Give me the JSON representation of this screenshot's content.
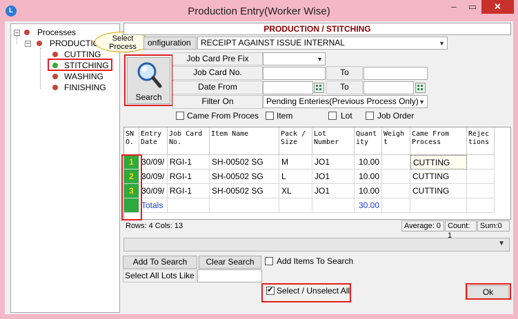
{
  "window": {
    "title": "Production Entry(Worker Wise)",
    "app_icon": "L",
    "min_glyph": "–",
    "max_glyph": "▭",
    "close_glyph": "✕"
  },
  "tree": {
    "root": "Processes",
    "parent": "PRODUCTION",
    "items": [
      "CUTTING",
      "STITCHING",
      "WASHING",
      "FINISHING"
    ],
    "selected": "STITCHING"
  },
  "callout": {
    "line1": "Select",
    "line2": "Process"
  },
  "header": {
    "title": "PRODUCTION / STITCHING"
  },
  "config": {
    "button_label": "onfiguration",
    "selected_value": "RECEIPT AGAINST ISSUE INTERNAL"
  },
  "search": {
    "button_label": "Search"
  },
  "fields": {
    "job_card_prefix_label": "Job Card Pre Fix",
    "job_card_no_label": "Job Card No.",
    "date_from_label": "Date From",
    "filter_on_label": "Filter On",
    "to_label": "To",
    "filter_value": "Pending Enteries(Previous Process Only)"
  },
  "checks": {
    "came_from_process": "Came  From Proces",
    "item": "Item",
    "lot": "Lot",
    "job_order": "Job Order"
  },
  "grid": {
    "headers": [
      "SN\nO.",
      "Entry\nDate",
      "Job Card\nNo.",
      "Item Name",
      "Pack /\nSize",
      "Lot\nNumber",
      "Quant\nity",
      "Weigh\nt",
      "Came From\nProcess",
      "Rejec\ntions"
    ],
    "rows": [
      {
        "sn": "1",
        "entry_date": "30/09/",
        "job_card": "RGI-1",
        "item": "SH-00502 SG",
        "pack_size": "M",
        "lot": "JO1",
        "qty": "10.00",
        "weight": "",
        "came_from": "CUTTING",
        "rejections": ""
      },
      {
        "sn": "2",
        "entry_date": "30/09/",
        "job_card": "RGI-1",
        "item": "SH-00502 SG",
        "pack_size": "L",
        "lot": "JO1",
        "qty": "10.00",
        "weight": "",
        "came_from": "CUTTING",
        "rejections": ""
      },
      {
        "sn": "3",
        "entry_date": "30/09/",
        "job_card": "RGI-1",
        "item": "SH-00502 SG",
        "pack_size": "XL",
        "lot": "JO1",
        "qty": "10.00",
        "weight": "",
        "came_from": "CUTTING",
        "rejections": ""
      }
    ],
    "totals_label": "Totals",
    "totals_qty": "30.00"
  },
  "status": {
    "rows_cols": "Rows: 4  Cols: 13",
    "average": "Average: 0",
    "count": "Count: 1",
    "sum": "Sum:0"
  },
  "actions": {
    "add_to_search": "Add To Search",
    "clear_search": "Clear Search",
    "add_items_to_search": "Add Items To Search",
    "select_all_lots_like": "Select All Lots Like",
    "select_unselect_all": "Select / Unselect All",
    "ok": "Ok"
  },
  "colors": {
    "accent_red": "#e02020",
    "header_text": "#8b0000",
    "sn_green": "#2eaa3e",
    "totals_blue": "#1a3fd6"
  }
}
